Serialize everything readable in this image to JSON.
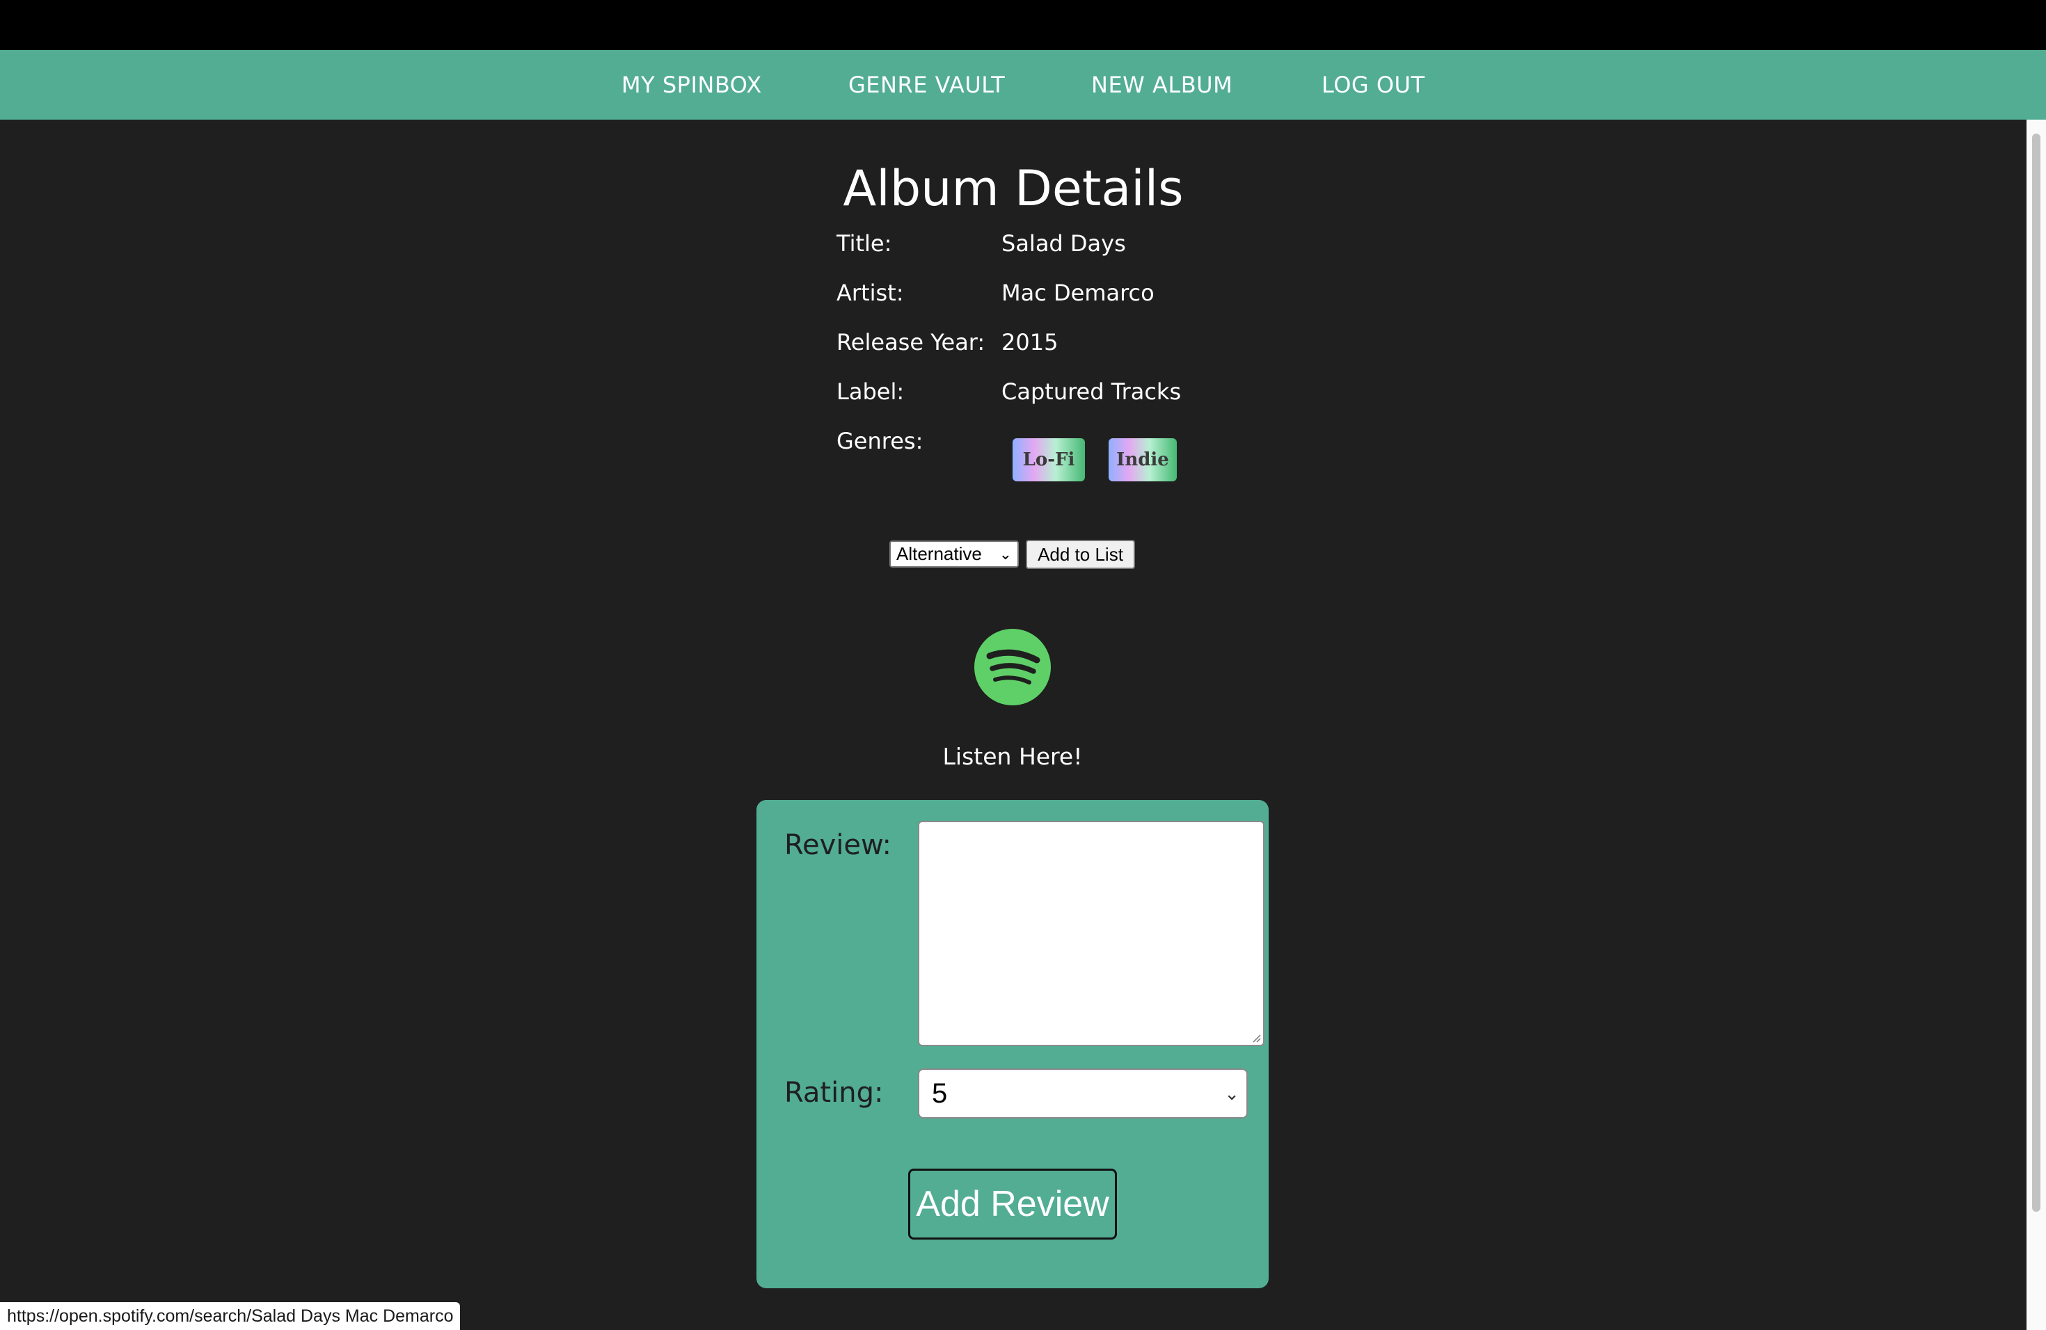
{
  "nav": {
    "items": [
      {
        "label": "MY SPINBOX"
      },
      {
        "label": "GENRE VAULT"
      },
      {
        "label": "NEW ALBUM"
      },
      {
        "label": "LOG OUT"
      }
    ]
  },
  "page": {
    "title": "Album Details"
  },
  "details": {
    "title_label": "Title:",
    "title_value": "Salad Days",
    "artist_label": "Artist:",
    "artist_value": "Mac Demarco",
    "year_label": "Release Year:",
    "year_value": "2015",
    "record_label_label": "Label:",
    "record_label_value": "Captured Tracks",
    "genres_label": "Genres:",
    "genres": [
      "Lo-Fi",
      "Indie"
    ]
  },
  "add_genre": {
    "selected": "Alternative",
    "button_label": "Add to List"
  },
  "spotify": {
    "icon": "spotify-icon",
    "listen_label": "Listen Here!"
  },
  "review_form": {
    "review_label": "Review:",
    "review_value": "",
    "rating_label": "Rating:",
    "rating_selected": "5",
    "submit_label": "Add Review"
  },
  "status_bar": {
    "url": "https://open.spotify.com/search/Salad Days Mac Demarco"
  },
  "colors": {
    "nav_bg": "#52ad93",
    "page_bg": "#1f1f1f",
    "spotify_green": "#5fd068"
  }
}
